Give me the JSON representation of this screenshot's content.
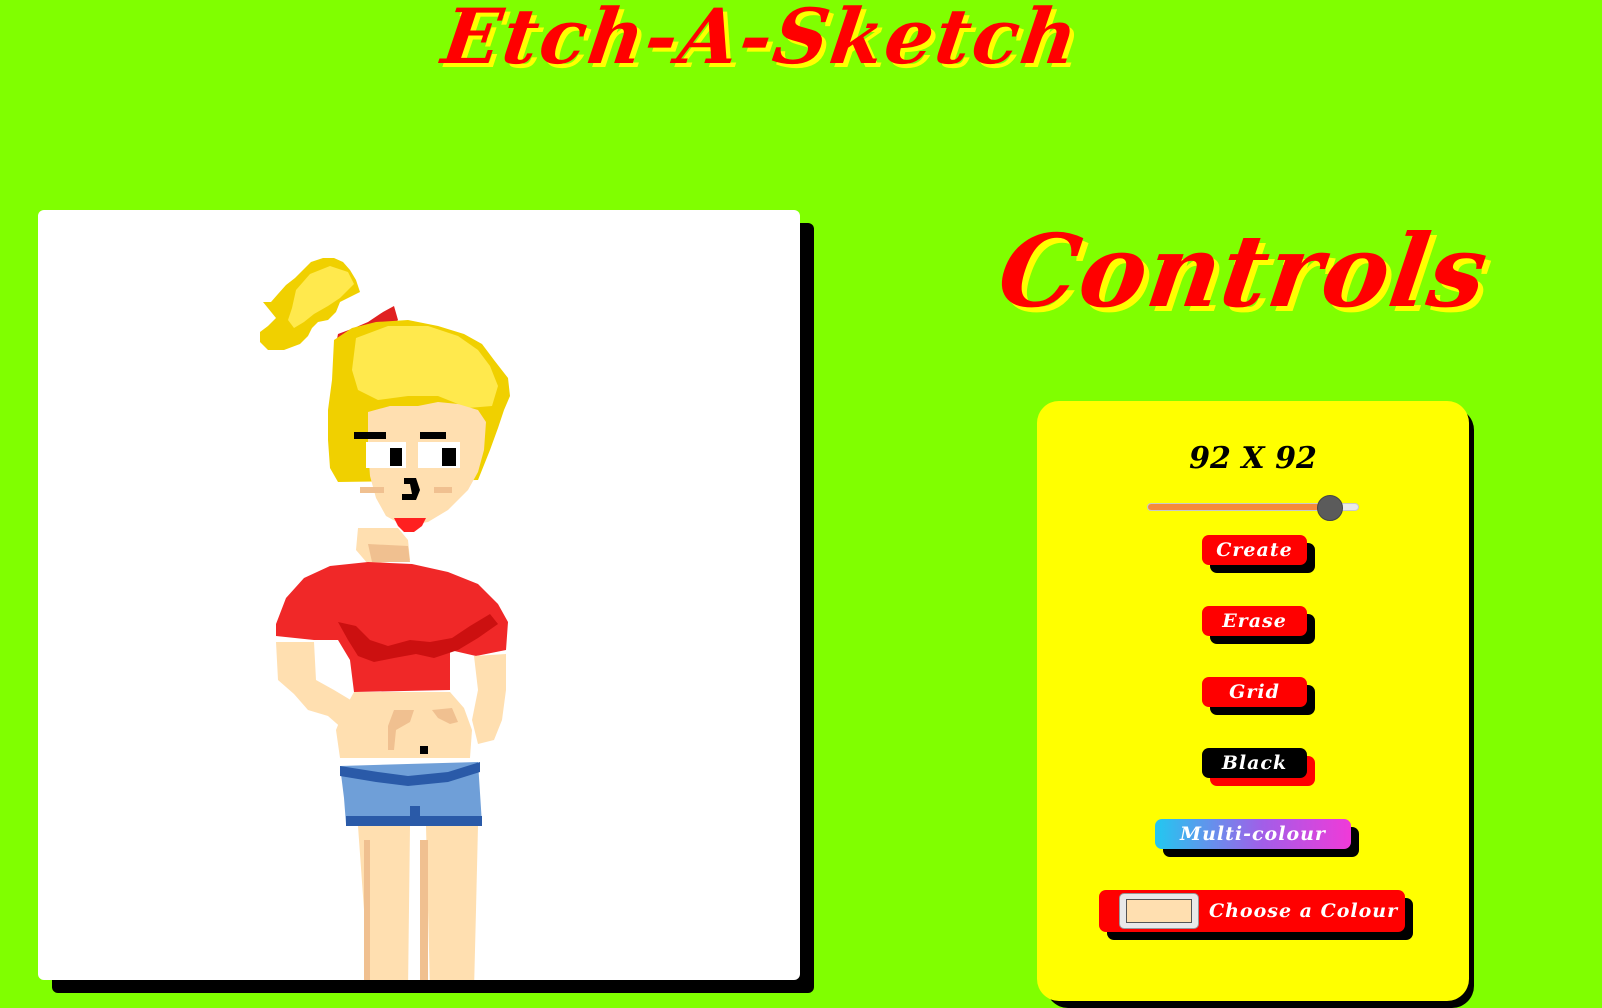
{
  "app": {
    "title": "Etch-A-Sketch"
  },
  "controls": {
    "title": "Controls",
    "grid_size_label": "92 X 92",
    "grid_size_value": 92,
    "slider_fraction": 0.86,
    "buttons": {
      "create": "Create",
      "erase": "Erase",
      "grid": "Grid",
      "black": "Black",
      "multi": "Multi-colour",
      "choose": "Choose a Colour"
    },
    "chosen_colour": "#ffdfb0"
  },
  "colors": {
    "background": "#80ff00",
    "accent": "#ff0000",
    "panel": "#ffff00",
    "shadow": "#000000"
  }
}
